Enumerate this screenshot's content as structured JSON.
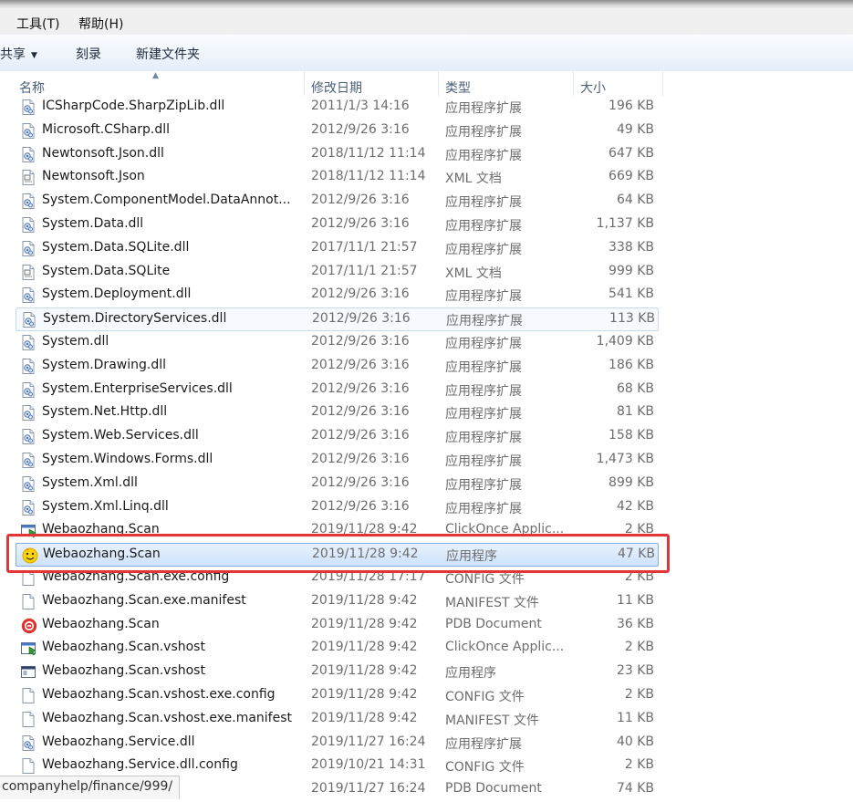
{
  "menu": {
    "tools": "工具(T)",
    "help": "帮助(H)"
  },
  "toolbar": {
    "share": "共享",
    "burn": "刻录",
    "new_folder": "新建文件夹"
  },
  "columns": {
    "name": "名称",
    "date": "修改日期",
    "type": "类型",
    "size": "大小"
  },
  "files": [
    {
      "name": "ICSharpCode.SharpZipLib.dll",
      "date": "2011/1/3 14:16",
      "type": "应用程序扩展",
      "size": "196 KB",
      "icon": "dll-icon"
    },
    {
      "name": "Microsoft.CSharp.dll",
      "date": "2012/9/26 3:16",
      "type": "应用程序扩展",
      "size": "49 KB",
      "icon": "dll-icon"
    },
    {
      "name": "Newtonsoft.Json.dll",
      "date": "2018/11/12 11:14",
      "type": "应用程序扩展",
      "size": "647 KB",
      "icon": "dll-icon"
    },
    {
      "name": "Newtonsoft.Json",
      "date": "2018/11/12 11:14",
      "type": "XML 文档",
      "size": "669 KB",
      "icon": "xml-icon"
    },
    {
      "name": "System.ComponentModel.DataAnnot...",
      "date": "2012/9/26 3:16",
      "type": "应用程序扩展",
      "size": "64 KB",
      "icon": "dll-icon"
    },
    {
      "name": "System.Data.dll",
      "date": "2012/9/26 3:16",
      "type": "应用程序扩展",
      "size": "1,137 KB",
      "icon": "dll-icon"
    },
    {
      "name": "System.Data.SQLite.dll",
      "date": "2017/11/1 21:57",
      "type": "应用程序扩展",
      "size": "338 KB",
      "icon": "dll-icon"
    },
    {
      "name": "System.Data.SQLite",
      "date": "2017/11/1 21:57",
      "type": "XML 文档",
      "size": "999 KB",
      "icon": "xml-icon"
    },
    {
      "name": "System.Deployment.dll",
      "date": "2012/9/26 3:16",
      "type": "应用程序扩展",
      "size": "541 KB",
      "icon": "dll-icon"
    },
    {
      "name": "System.DirectoryServices.dll",
      "date": "2012/9/26 3:16",
      "type": "应用程序扩展",
      "size": "113 KB",
      "icon": "dll-icon",
      "state": "hover"
    },
    {
      "name": "System.dll",
      "date": "2012/9/26 3:16",
      "type": "应用程序扩展",
      "size": "1,409 KB",
      "icon": "dll-icon"
    },
    {
      "name": "System.Drawing.dll",
      "date": "2012/9/26 3:16",
      "type": "应用程序扩展",
      "size": "186 KB",
      "icon": "dll-icon"
    },
    {
      "name": "System.EnterpriseServices.dll",
      "date": "2012/9/26 3:16",
      "type": "应用程序扩展",
      "size": "68 KB",
      "icon": "dll-icon"
    },
    {
      "name": "System.Net.Http.dll",
      "date": "2012/9/26 3:16",
      "type": "应用程序扩展",
      "size": "81 KB",
      "icon": "dll-icon"
    },
    {
      "name": "System.Web.Services.dll",
      "date": "2012/9/26 3:16",
      "type": "应用程序扩展",
      "size": "158 KB",
      "icon": "dll-icon"
    },
    {
      "name": "System.Windows.Forms.dll",
      "date": "2012/9/26 3:16",
      "type": "应用程序扩展",
      "size": "1,473 KB",
      "icon": "dll-icon"
    },
    {
      "name": "System.Xml.dll",
      "date": "2012/9/26 3:16",
      "type": "应用程序扩展",
      "size": "899 KB",
      "icon": "dll-icon"
    },
    {
      "name": "System.Xml.Linq.dll",
      "date": "2012/9/26 3:16",
      "type": "应用程序扩展",
      "size": "42 KB",
      "icon": "dll-icon"
    },
    {
      "name": "Webaozhang.Scan",
      "date": "2019/11/28 9:42",
      "type": "ClickOnce Applic...",
      "size": "2 KB",
      "icon": "clickonce-icon"
    },
    {
      "name": "Webaozhang.Scan",
      "date": "2019/11/28 9:42",
      "type": "应用程序",
      "size": "47 KB",
      "icon": "app-smiley-icon",
      "state": "selected"
    },
    {
      "name": "Webaozhang.Scan.exe.config",
      "date": "2019/11/28 17:17",
      "type": "CONFIG 文件",
      "size": "2 KB",
      "icon": "file-icon"
    },
    {
      "name": "Webaozhang.Scan.exe.manifest",
      "date": "2019/11/28 9:42",
      "type": "MANIFEST 文件",
      "size": "11 KB",
      "icon": "file-icon"
    },
    {
      "name": "Webaozhang.Scan",
      "date": "2019/11/28 9:42",
      "type": "PDB Document",
      "size": "36 KB",
      "icon": "pdb-icon"
    },
    {
      "name": "Webaozhang.Scan.vshost",
      "date": "2019/11/28 9:42",
      "type": "ClickOnce Applic...",
      "size": "2 KB",
      "icon": "clickonce-icon"
    },
    {
      "name": "Webaozhang.Scan.vshost",
      "date": "2019/11/28 9:42",
      "type": "应用程序",
      "size": "23 KB",
      "icon": "app-window-icon"
    },
    {
      "name": "Webaozhang.Scan.vshost.exe.config",
      "date": "2019/11/28 9:42",
      "type": "CONFIG 文件",
      "size": "2 KB",
      "icon": "file-icon"
    },
    {
      "name": "Webaozhang.Scan.vshost.exe.manifest",
      "date": "2019/11/28 9:42",
      "type": "MANIFEST 文件",
      "size": "11 KB",
      "icon": "file-icon"
    },
    {
      "name": "Webaozhang.Service.dll",
      "date": "2019/11/27 16:24",
      "type": "应用程序扩展",
      "size": "40 KB",
      "icon": "dll-icon"
    },
    {
      "name": "Webaozhang.Service.dll.config",
      "date": "2019/10/21 14:31",
      "type": "CONFIG 文件",
      "size": "2 KB",
      "icon": "file-icon"
    },
    {
      "name": "",
      "date": "2019/11/27 16:24",
      "type": "PDB Document",
      "size": "74 KB",
      "icon": "none"
    }
  ],
  "status": {
    "url": "companyhelp/finance/999/"
  },
  "colors": {
    "selection": "#cde2fb",
    "highlight_box": "#e33535",
    "pdb_red": "#e0342d"
  }
}
